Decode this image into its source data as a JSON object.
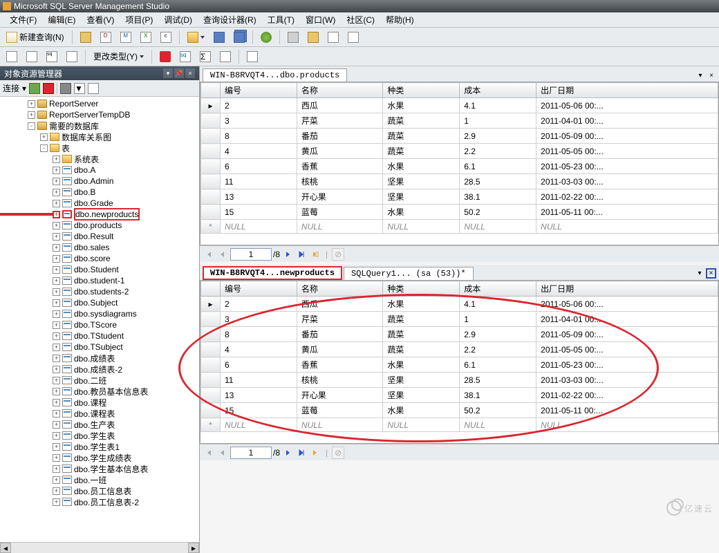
{
  "title_bar": {
    "app": "Microsoft SQL Server Management Studio"
  },
  "menu": {
    "file": "文件(F)",
    "edit": "编辑(E)",
    "view": "查看(V)",
    "project": "项目(P)",
    "debug": "调试(D)",
    "designer": "查询设计器(R)",
    "tools": "工具(T)",
    "window": "窗口(W)",
    "community": "社区(C)",
    "help": "帮助(H)"
  },
  "toolbar1": {
    "new_query": "新建查询(N)"
  },
  "toolbar2": {
    "change_type": "更改类型(Y)"
  },
  "sidebar": {
    "title": "对象资源管理器",
    "connect": "连接",
    "nodes": [
      {
        "indent": 40,
        "exp": "+",
        "ico": "db",
        "label": "ReportServer"
      },
      {
        "indent": 40,
        "exp": "+",
        "ico": "db",
        "label": "ReportServerTempDB"
      },
      {
        "indent": 40,
        "exp": "-",
        "ico": "db",
        "label": "需要的数据库"
      },
      {
        "indent": 58,
        "exp": "+",
        "ico": "folder",
        "label": "数据库关系图"
      },
      {
        "indent": 58,
        "exp": "-",
        "ico": "folder",
        "label": "表"
      },
      {
        "indent": 76,
        "exp": "+",
        "ico": "folder",
        "label": "系统表"
      },
      {
        "indent": 76,
        "exp": "+",
        "ico": "tbl",
        "label": "dbo.A"
      },
      {
        "indent": 76,
        "exp": "+",
        "ico": "tbl",
        "label": "dbo.Admin"
      },
      {
        "indent": 76,
        "exp": "+",
        "ico": "tbl",
        "label": "dbo.B"
      },
      {
        "indent": 76,
        "exp": "+",
        "ico": "tbl",
        "label": "dbo.Grade"
      },
      {
        "indent": 76,
        "exp": "+",
        "ico": "tbl",
        "label": "dbo.newproducts",
        "hl": true
      },
      {
        "indent": 76,
        "exp": "+",
        "ico": "tbl",
        "label": "dbo.products"
      },
      {
        "indent": 76,
        "exp": "+",
        "ico": "tbl",
        "label": "dbo.Result"
      },
      {
        "indent": 76,
        "exp": "+",
        "ico": "tbl",
        "label": "dbo.sales"
      },
      {
        "indent": 76,
        "exp": "+",
        "ico": "tbl",
        "label": "dbo.score"
      },
      {
        "indent": 76,
        "exp": "+",
        "ico": "tbl",
        "label": "dbo.Student"
      },
      {
        "indent": 76,
        "exp": "+",
        "ico": "tbl",
        "label": "dbo.student-1"
      },
      {
        "indent": 76,
        "exp": "+",
        "ico": "tbl",
        "label": "dbo.students-2"
      },
      {
        "indent": 76,
        "exp": "+",
        "ico": "tbl",
        "label": "dbo.Subject"
      },
      {
        "indent": 76,
        "exp": "+",
        "ico": "tbl",
        "label": "dbo.sysdiagrams"
      },
      {
        "indent": 76,
        "exp": "+",
        "ico": "tbl",
        "label": "dbo.TScore"
      },
      {
        "indent": 76,
        "exp": "+",
        "ico": "tbl",
        "label": "dbo.TStudent"
      },
      {
        "indent": 76,
        "exp": "+",
        "ico": "tbl",
        "label": "dbo.TSubject"
      },
      {
        "indent": 76,
        "exp": "+",
        "ico": "tbl",
        "label": "dbo.成绩表"
      },
      {
        "indent": 76,
        "exp": "+",
        "ico": "tbl",
        "label": "dbo.成绩表-2"
      },
      {
        "indent": 76,
        "exp": "+",
        "ico": "tbl",
        "label": "dbo.二班"
      },
      {
        "indent": 76,
        "exp": "+",
        "ico": "tbl",
        "label": "dbo.教员基本信息表"
      },
      {
        "indent": 76,
        "exp": "+",
        "ico": "tbl",
        "label": "dbo.课程"
      },
      {
        "indent": 76,
        "exp": "+",
        "ico": "tbl",
        "label": "dbo.课程表"
      },
      {
        "indent": 76,
        "exp": "+",
        "ico": "tbl",
        "label": "dbo.生产表"
      },
      {
        "indent": 76,
        "exp": "+",
        "ico": "tbl",
        "label": "dbo.学生表"
      },
      {
        "indent": 76,
        "exp": "+",
        "ico": "tbl",
        "label": "dbo.学生表1"
      },
      {
        "indent": 76,
        "exp": "+",
        "ico": "tbl",
        "label": "dbo.学生成绩表"
      },
      {
        "indent": 76,
        "exp": "+",
        "ico": "tbl",
        "label": "dbo.学生基本信息表"
      },
      {
        "indent": 76,
        "exp": "+",
        "ico": "tbl",
        "label": "dbo.一班"
      },
      {
        "indent": 76,
        "exp": "+",
        "ico": "tbl",
        "label": "dbo.员工信息表"
      },
      {
        "indent": 76,
        "exp": "+",
        "ico": "tbl",
        "label": "dbo.员工信息表-2"
      }
    ]
  },
  "docs": {
    "top": {
      "tab": "WIN-B8RVQT4...dbo.products",
      "cols": [
        "编号",
        "名称",
        "种类",
        "成本",
        "出厂日期"
      ],
      "rows": [
        [
          "2",
          "西瓜",
          "水果",
          "4.1",
          "2011-05-06 00:..."
        ],
        [
          "3",
          "芹菜",
          "蔬菜",
          "1",
          "2011-04-01 00:..."
        ],
        [
          "8",
          "番茄",
          "蔬菜",
          "2.9",
          "2011-05-09 00:..."
        ],
        [
          "4",
          "黄瓜",
          "蔬菜",
          "2.2",
          "2011-05-05 00:..."
        ],
        [
          "6",
          "香蕉",
          "水果",
          "6.1",
          "2011-05-23 00:..."
        ],
        [
          "11",
          "核桃",
          "坚果",
          "28.5",
          "2011-03-03 00:..."
        ],
        [
          "13",
          "开心果",
          "坚果",
          "38.1",
          "2011-02-22 00:..."
        ],
        [
          "15",
          "蓝莓",
          "水果",
          "50.2",
          "2011-05-11 00:..."
        ]
      ],
      "null_row": [
        "NULL",
        "NULL",
        "NULL",
        "NULL",
        "NULL"
      ]
    },
    "bottom": {
      "tab_active": "WIN-B8RVQT4...newproducts",
      "tab_other": "SQLQuery1... (sa (53))*",
      "cols": [
        "编号",
        "名称",
        "种类",
        "成本",
        "出厂日期"
      ],
      "rows": [
        [
          "2",
          "西瓜",
          "水果",
          "4.1",
          "2011-05-06 00:..."
        ],
        [
          "3",
          "芹菜",
          "蔬菜",
          "1",
          "2011-04-01 00:..."
        ],
        [
          "8",
          "番茄",
          "蔬菜",
          "2.9",
          "2011-05-09 00:..."
        ],
        [
          "4",
          "黄瓜",
          "蔬菜",
          "2.2",
          "2011-05-05 00:..."
        ],
        [
          "6",
          "香蕉",
          "水果",
          "6.1",
          "2011-05-23 00:..."
        ],
        [
          "11",
          "核桃",
          "坚果",
          "28.5",
          "2011-03-03 00:..."
        ],
        [
          "13",
          "开心果",
          "坚果",
          "38.1",
          "2011-02-22 00:..."
        ],
        [
          "15",
          "蓝莓",
          "水果",
          "50.2",
          "2011-05-11 00:..."
        ]
      ],
      "null_row": [
        "NULL",
        "NULL",
        "NULL",
        "NULL",
        "NULL"
      ]
    }
  },
  "pager": {
    "current": "1",
    "total": "/8",
    "separator": "|"
  },
  "watermark": "亿速云"
}
